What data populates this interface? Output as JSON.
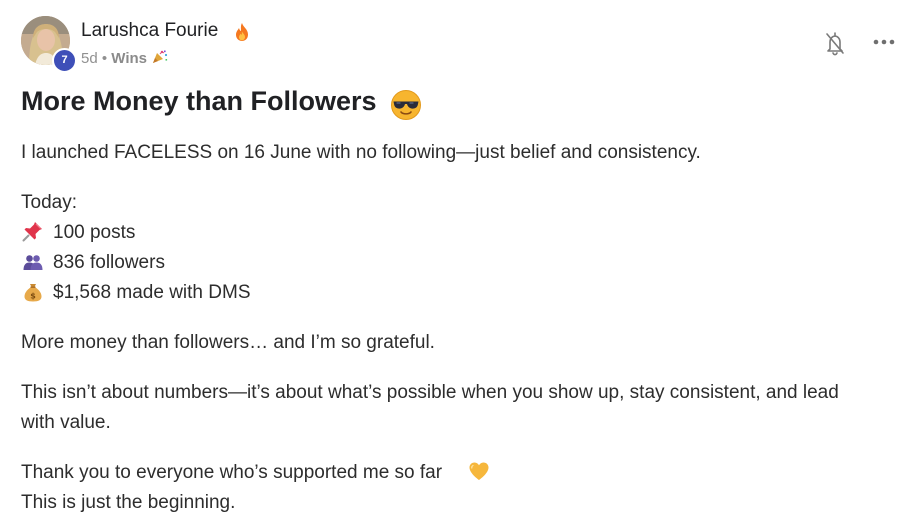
{
  "author": {
    "name": "Larushca Fourie",
    "level": "7",
    "time_ago": "5d",
    "separator": "•",
    "category": "Wins"
  },
  "post": {
    "title": "More Money than Followers",
    "intro": "I launched FACELESS on 16 June with no following—just belief and consistency.",
    "today_label": "Today:",
    "stats": [
      {
        "icon": "pushpin-icon",
        "text": "100 posts"
      },
      {
        "icon": "people-icon",
        "text": "836 followers"
      },
      {
        "icon": "money-bag-icon",
        "text": "$1,568 made with DMS"
      }
    ],
    "grateful": "More money than followers… and I’m so grateful.",
    "numbers_line1": "This isn’t about numbers—it’s about what’s possible when you show up, stay consistent, and lead",
    "numbers_line2": "with value.",
    "thanks": "Thank you to everyone who’s supported me so far",
    "beginning": "This is just the beginning."
  },
  "icons": {
    "author_badge": "flame-icon",
    "title_emoji": "sunglasses-face-icon",
    "category_emoji": "party-popper-icon",
    "thanks_emoji": "yellow-heart-icon",
    "notify": "bell-off-icon",
    "menu": "more-options-icon"
  },
  "colors": {
    "level_badge": "#3e4fb8",
    "meta_text": "#909090",
    "body_text": "#2d2d2d"
  }
}
